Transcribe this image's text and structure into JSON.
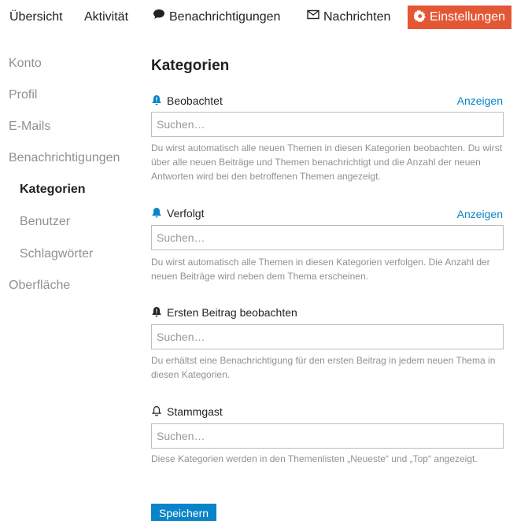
{
  "nav": {
    "items": [
      {
        "label": "Übersicht"
      },
      {
        "label": "Aktivität"
      },
      {
        "label": "Benachrichtigungen"
      },
      {
        "label": "Nachrichten"
      },
      {
        "label": "Einstellungen"
      }
    ]
  },
  "sidebar": {
    "items": [
      {
        "label": "Konto"
      },
      {
        "label": "Profil"
      },
      {
        "label": "E-Mails"
      },
      {
        "label": "Benachrichtigungen"
      },
      {
        "label": "Kategorien"
      },
      {
        "label": "Benutzer"
      },
      {
        "label": "Schlagwörter"
      },
      {
        "label": "Oberfläche"
      }
    ]
  },
  "main": {
    "title": "Kategorien",
    "sections": [
      {
        "label": "Beobachtet",
        "show_label": "Anzeigen",
        "placeholder": "Suchen…",
        "description": "Du wirst automatisch alle neuen Themen in diesen Kategorien beobachten. Du wirst über alle neuen Beiträge und Themen benachrichtigt und die Anzahl der neuen Antworten wird bei den betroffenen Themen angezeigt."
      },
      {
        "label": "Verfolgt",
        "show_label": "Anzeigen",
        "placeholder": "Suchen…",
        "description": "Du wirst automatisch alle Themen in diesen Kategorien verfolgen. Die Anzahl der neuen Beiträge wird neben dem Thema erscheinen."
      },
      {
        "label": "Ersten Beitrag beobachten",
        "placeholder": "Suchen…",
        "description": "Du erhältst eine Benachrichtigung für den ersten Beitrag in jedem neuen Thema in diesen Kategorien."
      },
      {
        "label": "Stammgast",
        "placeholder": "Suchen…",
        "description": "Diese Kategorien werden in den Themenlisten „Neueste“ und „Top“ angezeigt."
      }
    ],
    "save_label": "Speichern"
  },
  "colors": {
    "accent": "#e45735",
    "link": "#0a84c8",
    "muted": "#919191"
  },
  "icons": {
    "watching": "bell-exclamation-icon",
    "tracking": "bell-icon",
    "watching_first": "bell-exclamation-icon",
    "regular": "bell-outline-icon"
  }
}
